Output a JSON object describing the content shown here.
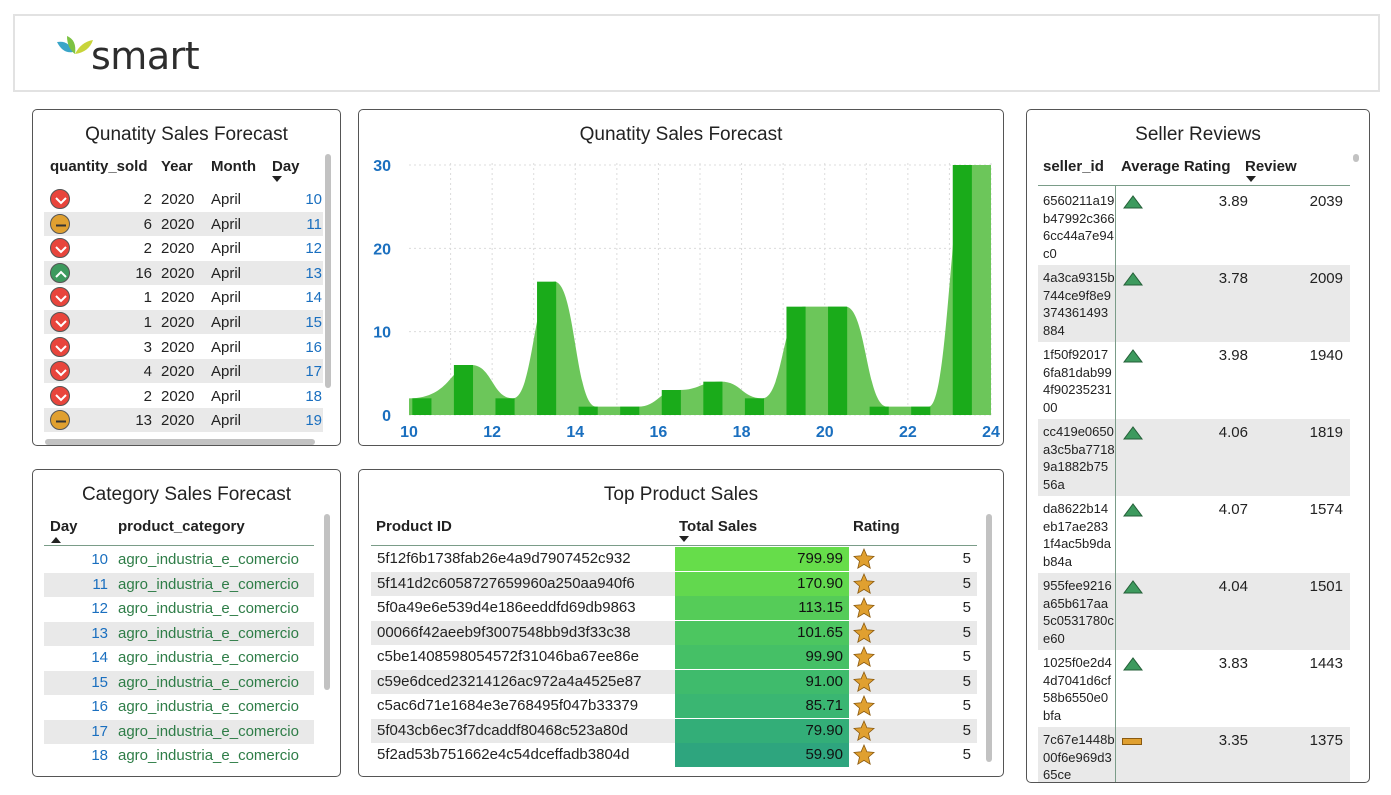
{
  "logo": {
    "text": "smart"
  },
  "quantity_table": {
    "title": "Qunatity Sales Forecast",
    "columns": [
      "quantity_sold",
      "Year",
      "Month",
      "Day"
    ],
    "sort_column": "Day",
    "rows": [
      {
        "status": "down",
        "quantity_sold": "2",
        "year": "2020",
        "month": "April",
        "day": "10"
      },
      {
        "status": "mid",
        "quantity_sold": "6",
        "year": "2020",
        "month": "April",
        "day": "11"
      },
      {
        "status": "down",
        "quantity_sold": "2",
        "year": "2020",
        "month": "April",
        "day": "12"
      },
      {
        "status": "up",
        "quantity_sold": "16",
        "year": "2020",
        "month": "April",
        "day": "13"
      },
      {
        "status": "down",
        "quantity_sold": "1",
        "year": "2020",
        "month": "April",
        "day": "14"
      },
      {
        "status": "down",
        "quantity_sold": "1",
        "year": "2020",
        "month": "April",
        "day": "15"
      },
      {
        "status": "down",
        "quantity_sold": "3",
        "year": "2020",
        "month": "April",
        "day": "16"
      },
      {
        "status": "down",
        "quantity_sold": "4",
        "year": "2020",
        "month": "April",
        "day": "17"
      },
      {
        "status": "down",
        "quantity_sold": "2",
        "year": "2020",
        "month": "April",
        "day": "18"
      },
      {
        "status": "mid",
        "quantity_sold": "13",
        "year": "2020",
        "month": "April",
        "day": "19"
      }
    ]
  },
  "chart_data": {
    "type": "bar",
    "title": "Qunatity Sales Forecast",
    "x": [
      10,
      11,
      12,
      13,
      14,
      15,
      16,
      17,
      18,
      19,
      20,
      21,
      22,
      23
    ],
    "values": [
      2,
      6,
      2,
      16,
      1,
      1,
      3,
      4,
      2,
      13,
      13,
      1,
      1,
      30
    ],
    "xticks": [
      "10",
      "12",
      "14",
      "16",
      "18",
      "20",
      "22",
      "24"
    ],
    "yticks": [
      "0",
      "10",
      "20",
      "30"
    ],
    "xlim": [
      10,
      24
    ],
    "ylim": [
      0,
      30
    ],
    "grid": true,
    "colors": {
      "bar": "#1aab1a",
      "area": "#6cc65a",
      "axis_text": "#1a6fbf"
    }
  },
  "category_table": {
    "title": "Category Sales Forecast",
    "columns": [
      "Day",
      "product_category"
    ],
    "sort_column": "Day",
    "rows": [
      {
        "day": "10",
        "category": "agro_industria_e_comercio"
      },
      {
        "day": "11",
        "category": "agro_industria_e_comercio"
      },
      {
        "day": "12",
        "category": "agro_industria_e_comercio"
      },
      {
        "day": "13",
        "category": "agro_industria_e_comercio"
      },
      {
        "day": "14",
        "category": "agro_industria_e_comercio"
      },
      {
        "day": "15",
        "category": "agro_industria_e_comercio"
      },
      {
        "day": "16",
        "category": "agro_industria_e_comercio"
      },
      {
        "day": "17",
        "category": "agro_industria_e_comercio"
      },
      {
        "day": "18",
        "category": "agro_industria_e_comercio"
      }
    ]
  },
  "product_table": {
    "title": "Top Product Sales",
    "columns": [
      "Product ID",
      "Total Sales",
      "Rating"
    ],
    "sort_column": "Total Sales",
    "rows": [
      {
        "id": "5f12f6b1738fab26e4a9d7907452c932",
        "sales": "799.99",
        "rating": "5",
        "color": "#66dd4a"
      },
      {
        "id": "5f141d2c6058727659960a250aa940f6",
        "sales": "170.90",
        "rating": "5",
        "color": "#62d84e"
      },
      {
        "id": "5f0a49e6e539d4e186eeddfd69db9863",
        "sales": "113.15",
        "rating": "5",
        "color": "#55cc58"
      },
      {
        "id": "00066f42aeeb9f3007548bb9d3f33c38",
        "sales": "101.65",
        "rating": "5",
        "color": "#4cc660"
      },
      {
        "id": "c5be1408598054572f31046ba67ee86e",
        "sales": "99.90",
        "rating": "5",
        "color": "#45c066"
      },
      {
        "id": "c59e6dced23214126ac972a4a4525e87",
        "sales": "91.00",
        "rating": "5",
        "color": "#3fbb6c"
      },
      {
        "id": "c5ac6d71e1684e3e768495f047b33379",
        "sales": "85.71",
        "rating": "5",
        "color": "#3ab672"
      },
      {
        "id": "5f043cb6ec3f7dcaddf80468c523a80d",
        "sales": "79.90",
        "rating": "5",
        "color": "#33ae78"
      },
      {
        "id": "5f2ad53b751662e4c54dceffadb3804d",
        "sales": "59.90",
        "rating": "5",
        "color": "#2ea57e"
      }
    ]
  },
  "seller_table": {
    "title": "Seller Reviews",
    "columns": [
      "seller_id",
      "Average Rating",
      "Review"
    ],
    "sort_column": "Review",
    "rows": [
      {
        "id": "6560211a19b47992c3666cc44a7e94c0",
        "indicator": "up",
        "rating": "3.89",
        "review": "2039"
      },
      {
        "id": "4a3ca9315b744ce9f8e9374361493884",
        "indicator": "up",
        "rating": "3.78",
        "review": "2009"
      },
      {
        "id": "1f50f920176fa81dab994f9023523100",
        "indicator": "up",
        "rating": "3.98",
        "review": "1940"
      },
      {
        "id": "cc419e0650a3c5ba77189a1882b7556a",
        "indicator": "up",
        "rating": "4.06",
        "review": "1819"
      },
      {
        "id": "da8622b14eb17ae2831f4ac5b9dab84a",
        "indicator": "up",
        "rating": "4.07",
        "review": "1574"
      },
      {
        "id": "955fee9216a65b617aa5c0531780ce60",
        "indicator": "up",
        "rating": "4.04",
        "review": "1501"
      },
      {
        "id": "1025f0e2d44d7041d6cf58b6550e0bfa",
        "indicator": "up",
        "rating": "3.83",
        "review": "1443"
      },
      {
        "id": "7c67e1448b00f6e969d365ce",
        "indicator": "mid",
        "rating": "3.35",
        "review": "1375"
      }
    ]
  }
}
